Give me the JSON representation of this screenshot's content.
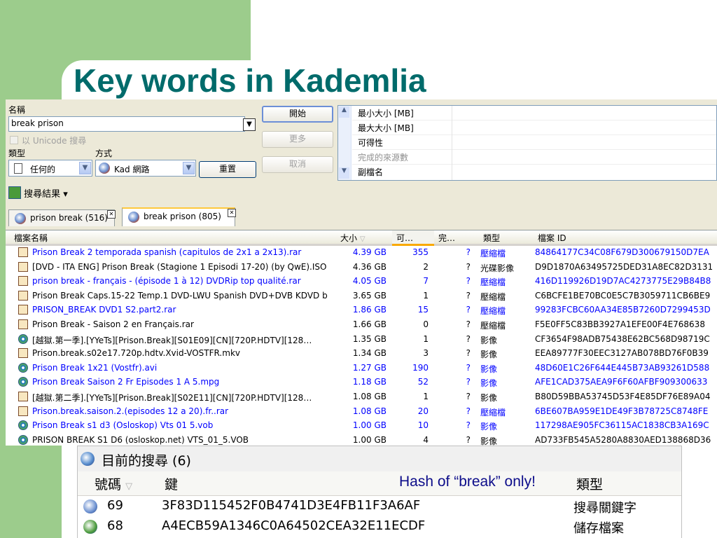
{
  "slide": {
    "title": "Key words in Kademlia"
  },
  "search_window": {
    "name_label": "名稱",
    "name_value": "break prison",
    "unicode_label": "以 Unicode 搜尋",
    "type_label": "類型",
    "type_value": "任何的",
    "method_label": "方式",
    "method_value": "Kad 網路",
    "start_button": "開始",
    "more_button": "更多",
    "cancel_button": "取消",
    "reset_button": "重置",
    "params": [
      "最小大小 [MB]",
      "最大大小 [MB]",
      "可得性",
      "完成的來源數",
      "副檔名"
    ],
    "results_label": "搜尋結果",
    "results_arrow": "▾",
    "tabs": [
      {
        "label": "prison break (516)"
      },
      {
        "label": "break prison (805)"
      }
    ],
    "columns": [
      "檔案名稱",
      "大小",
      "可…",
      "完…",
      "類型",
      "檔案 ID"
    ],
    "rows": [
      {
        "name": "Prison Break 2 temporada spanish (capitulos de 2x1 a 2x13).rar",
        "size": "4.39 GB",
        "avail": "355",
        "complete": "?",
        "type": "壓縮檔",
        "id": "84864177C34C08F679D300679150D7EA",
        "blue": true,
        "video": false
      },
      {
        "name": "[DVD - ITA ENG] Prison Break (Stagione 1 Episodi 17-20) (by QwE).ISO",
        "size": "4.36 GB",
        "avail": "2",
        "complete": "?",
        "type": "光碟影像",
        "id": "D9D1870A63495725DED31A8EC82D3131",
        "blue": false,
        "video": false
      },
      {
        "name": "prison break - français - (épisode 1 à 12) DVDRip top qualité.rar",
        "size": "4.05 GB",
        "avail": "7",
        "complete": "?",
        "type": "壓縮檔",
        "id": "416D119926D19D7AC4273775E29B84B8",
        "blue": true,
        "video": false
      },
      {
        "name": "Prison Break Caps.15-22 Temp.1 DVD-LWU Spanish DVD+DVB KDVD b…",
        "size": "3.65 GB",
        "avail": "1",
        "complete": "?",
        "type": "壓縮檔",
        "id": "C6BCFE1BE70BC0E5C7B3059711CB6BE9",
        "blue": false,
        "video": false
      },
      {
        "name": "PRISON_BREAK DVD1 S2.part2.rar",
        "size": "1.86 GB",
        "avail": "15",
        "complete": "?",
        "type": "壓縮檔",
        "id": "99283FCBC60AA34E85B7260D7299453D",
        "blue": true,
        "video": false
      },
      {
        "name": "Prison Break - Saison 2 en Français.rar",
        "size": "1.66 GB",
        "avail": "0",
        "complete": "?",
        "type": "壓縮檔",
        "id": "F5E0FF5C83BB3927A1EFE00F4E768638",
        "blue": false,
        "video": false
      },
      {
        "name": "[越獄.第一季].[YYeTs][Prison.Break][S01E09][CN][720P.HDTV][128…",
        "size": "1.35 GB",
        "avail": "1",
        "complete": "?",
        "type": "影像",
        "id": "CF3654F98ADB75438E62BC568D98719C",
        "blue": false,
        "video": true
      },
      {
        "name": "Prison.break.s02e17.720p.hdtv.Xvid-VOSTFR.mkv",
        "size": "1.34 GB",
        "avail": "3",
        "complete": "?",
        "type": "影像",
        "id": "EEA89777F30EEC3127AB078BD76F0B39",
        "blue": false,
        "video": false
      },
      {
        "name": "Prison Break 1x21 (Vostfr).avi",
        "size": "1.27 GB",
        "avail": "190",
        "complete": "?",
        "type": "影像",
        "id": "48D60E1C26F644E445B73AB93261D588",
        "blue": true,
        "video": true
      },
      {
        "name": "Prison Break Saison 2 Fr Episodes 1 A 5.mpg",
        "size": "1.18 GB",
        "avail": "52",
        "complete": "?",
        "type": "影像",
        "id": "AFE1CAD375AEA9F6F60AFBF909300633",
        "blue": true,
        "video": true
      },
      {
        "name": "[越獄.第二季].[YYeTs][Prison.Break][S02E11][CN][720P.HDTV][128…",
        "size": "1.08 GB",
        "avail": "1",
        "complete": "?",
        "type": "影像",
        "id": "B80D59BBA53745D53F4E85DF76E89A04",
        "blue": false,
        "video": false
      },
      {
        "name": "Prison.break.saison.2.(episodes 12 a 20).fr..rar",
        "size": "1.08 GB",
        "avail": "20",
        "complete": "?",
        "type": "壓縮檔",
        "id": "6BE607BA959E1DE49F3B78725C8748FE",
        "blue": true,
        "video": false
      },
      {
        "name": "Prison Break s1 d3 (Osloskop) Vts 01 5.vob",
        "size": "1.00 GB",
        "avail": "10",
        "complete": "?",
        "type": "影像",
        "id": "117298AE905FC36115AC1838CB3A169C",
        "blue": true,
        "video": true
      },
      {
        "name": "PRISON BREAK S1 D6 (osloskop.net) VTS_01_5.VOB",
        "size": "1.00 GB",
        "avail": "4",
        "complete": "?",
        "type": "影像",
        "id": "AD733FB545A5280A8830AED138868D36",
        "blue": false,
        "video": true
      }
    ]
  },
  "current_search": {
    "title": "目前的搜尋 (6)",
    "columns": [
      "號碼",
      "鍵",
      "類型"
    ],
    "rows": [
      {
        "num": "69",
        "key": "3F83D115452F0B4741D3E4FB11F3A6AF",
        "type": "搜尋關鍵字"
      },
      {
        "num": "68",
        "key": "A4ECB59A1346C0A64502CEA32E11ECDF",
        "type": "儲存檔案"
      }
    ]
  },
  "annotation": "Hash of “break” only!"
}
